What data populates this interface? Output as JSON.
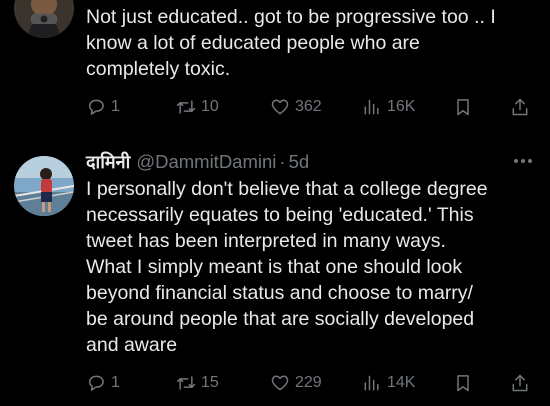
{
  "tweet1": {
    "text": "Not just educated.. got to be progressive too .. I\nknow a lot of educated people who are\ncompletely toxic.",
    "replies": "1",
    "retweets": "10",
    "likes": "362",
    "views": "16K"
  },
  "tweet2": {
    "display_name": "दामिनी",
    "handle": "@DammitDamini",
    "separator": "·",
    "time": "5d",
    "text": "I personally don't believe that a college degree\nnecessarily equates to being 'educated.' This\ntweet has been interpreted in many ways.\nWhat I simply meant is that one should look\nbeyond financial status and choose to marry/\nbe around people that are socially developed\nand aware",
    "replies": "1",
    "retweets": "15",
    "likes": "229",
    "views": "14K"
  },
  "icons": {
    "reply": "reply-icon",
    "retweet": "retweet-icon",
    "like": "heart-icon",
    "views": "views-icon",
    "bookmark": "bookmark-icon",
    "share": "share-icon",
    "more": "more-icon"
  },
  "colors": {
    "background": "#000000",
    "text": "#e7e9ea",
    "muted": "#71767b"
  }
}
